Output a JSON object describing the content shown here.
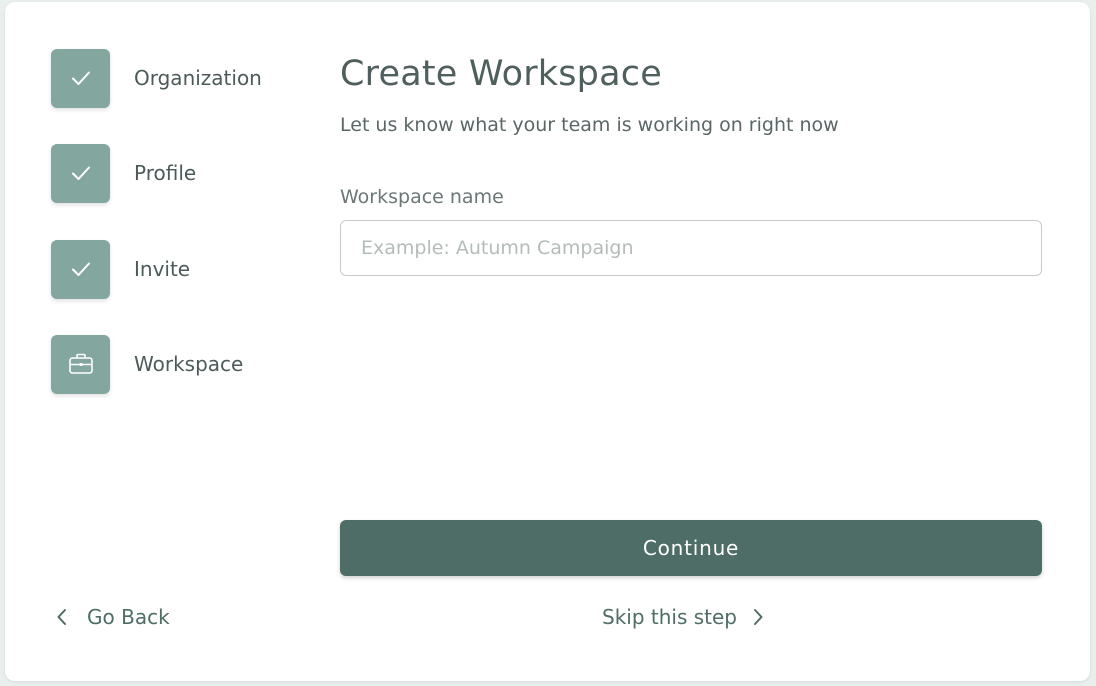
{
  "steps": [
    {
      "label": "Organization",
      "icon": "check-icon",
      "state": "complete"
    },
    {
      "label": "Profile",
      "icon": "check-icon",
      "state": "complete"
    },
    {
      "label": "Invite",
      "icon": "check-icon",
      "state": "complete"
    },
    {
      "label": "Workspace",
      "icon": "briefcase-icon",
      "state": "current"
    }
  ],
  "main": {
    "title": "Create Workspace",
    "subtitle": "Let us know what your team is working on right now",
    "field_label": "Workspace name",
    "field_placeholder": "Example: Autumn Campaign",
    "field_value": ""
  },
  "actions": {
    "continue_label": "Continue",
    "go_back_label": "Go Back",
    "skip_label": "Skip this step"
  },
  "colors": {
    "accent": "#4e6d66",
    "step_fill": "#83a69f",
    "text": "#4f5f5d"
  }
}
